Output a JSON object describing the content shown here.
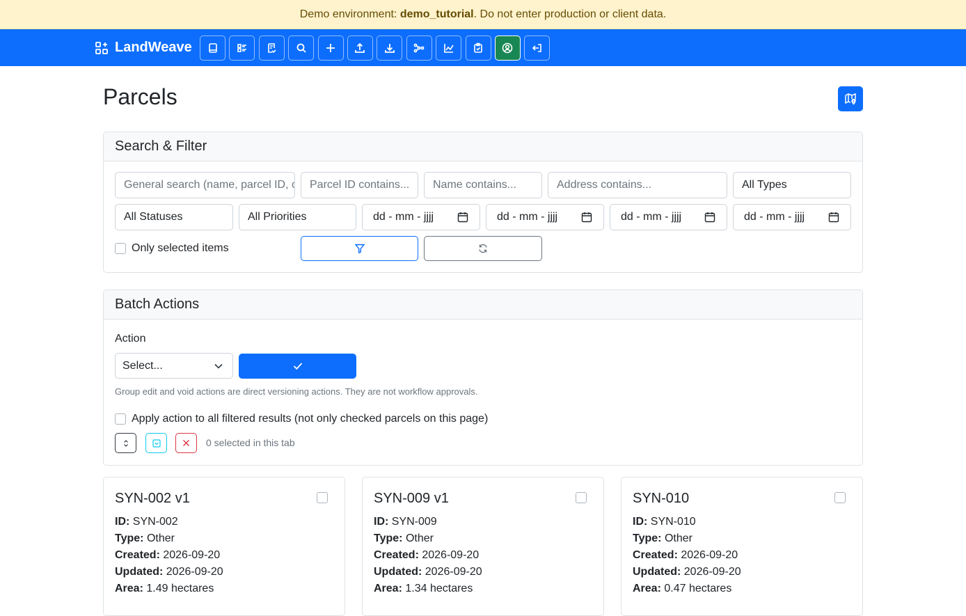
{
  "banner": {
    "prefix": "Demo environment: ",
    "env": "demo_tutorial",
    "suffix": ". Do not enter production or client data."
  },
  "app": {
    "name": "LandWeave"
  },
  "nav": {
    "icons": [
      "book-icon",
      "list-details-icon",
      "file-check-icon",
      "search-icon",
      "plus-icon",
      "upload-icon",
      "download-icon",
      "hierarchy-icon",
      "chart-icon",
      "clipboard-icon",
      "user-circle-icon",
      "logout-icon"
    ]
  },
  "page": {
    "title": "Parcels"
  },
  "filter": {
    "header": "Search & Filter",
    "general_placeholder": "General search (name, parcel ID, c",
    "parcel_id_placeholder": "Parcel ID contains...",
    "name_placeholder": "Name contains...",
    "address_placeholder": "Address contains...",
    "type_value": "All Types",
    "status_value": "All Statuses",
    "priority_value": "All Priorities",
    "date_placeholder": "dd - mm - jjjj",
    "only_selected_label": "Only selected items"
  },
  "batch": {
    "header": "Batch Actions",
    "action_label": "Action",
    "action_value": "Select...",
    "help_text": "Group edit and void actions are direct versioning actions. They are not workflow approvals.",
    "apply_all_label": "Apply action to all filtered results (not only checked parcels on this page)",
    "selected_count": "0 selected in this tab"
  },
  "parcels": [
    {
      "title": "SYN-002 v1",
      "id_label": "ID:",
      "id": "SYN-002",
      "type_label": "Type:",
      "type": "Other",
      "created_label": "Created:",
      "created": "2026-09-20",
      "updated_label": "Updated:",
      "updated": "2026-09-20",
      "area_label": "Area:",
      "area": "1.49 hectares"
    },
    {
      "title": "SYN-009 v1",
      "id_label": "ID:",
      "id": "SYN-009",
      "type_label": "Type:",
      "type": "Other",
      "created_label": "Created:",
      "created": "2026-09-20",
      "updated_label": "Updated:",
      "updated": "2026-09-20",
      "area_label": "Area:",
      "area": "1.34 hectares"
    },
    {
      "title": "SYN-010",
      "id_label": "ID:",
      "id": "SYN-010",
      "type_label": "Type:",
      "type": "Other",
      "created_label": "Created:",
      "created": "2026-09-20",
      "updated_label": "Updated:",
      "updated": "2026-09-20",
      "area_label": "Area:",
      "area": "0.47 hectares"
    }
  ],
  "colors": {
    "primary": "#0d6efd",
    "success": "#198754",
    "banner_bg": "#fff3cd",
    "banner_text": "#664d03",
    "danger": "#dc3545",
    "info": "#0dcaf0"
  }
}
